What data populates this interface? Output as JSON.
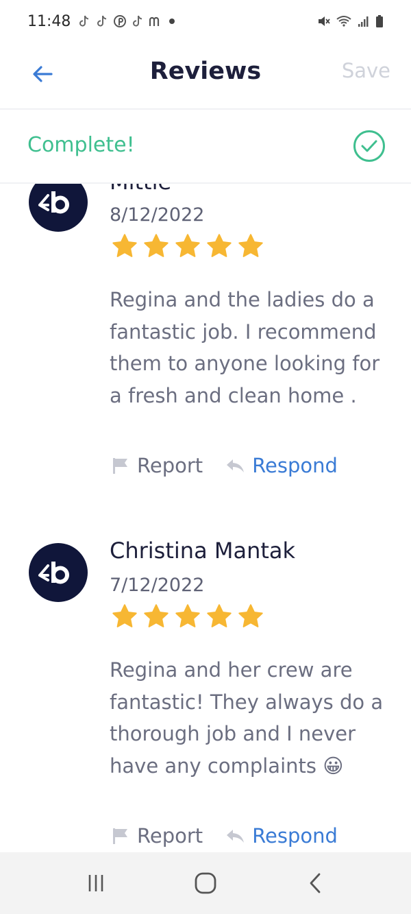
{
  "status_bar": {
    "time": "11:48"
  },
  "header": {
    "title": "Reviews",
    "save_label": "Save"
  },
  "status": {
    "complete_label": "Complete!"
  },
  "reviews": [
    {
      "name": "Mittie",
      "date": "8/12/2022",
      "rating": 5,
      "text": "Regina and the ladies do a fantastic job.  I recommend them to anyone looking for a fresh and clean home .",
      "report_label": "Report",
      "respond_label": "Respond"
    },
    {
      "name": "Christina Mantak",
      "date": "7/12/2022",
      "rating": 5,
      "text": "Regina and her crew are fantastic! They always do a thorough job and I never have any complaints 😀",
      "report_label": "Report",
      "respond_label": "Respond"
    }
  ],
  "colors": {
    "accent_green": "#3fbf8f",
    "link_blue": "#3a7bd5",
    "star_gold": "#f7b733",
    "avatar_navy": "#10163a"
  },
  "icons": {
    "back": "arrow-left-icon",
    "complete": "check-circle-icon",
    "report": "flag-icon",
    "respond": "reply-icon",
    "avatar_logo": "brand-logo-icon",
    "nav": [
      "recent-apps-icon",
      "home-icon",
      "back-nav-icon"
    ]
  }
}
